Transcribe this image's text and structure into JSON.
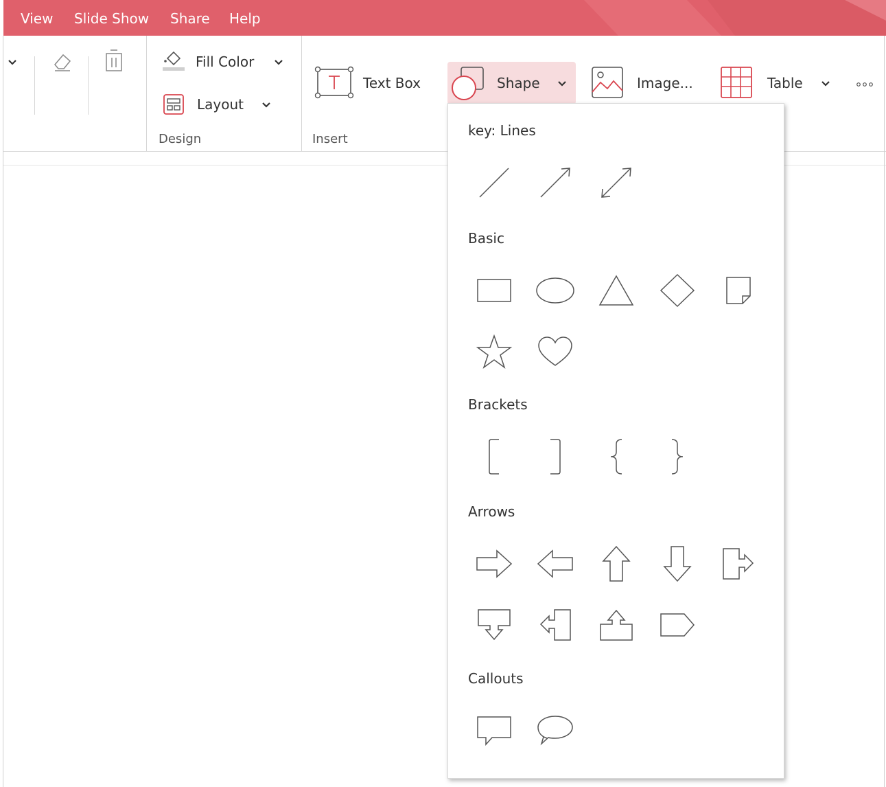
{
  "menubar": {
    "items": [
      "View",
      "Slide Show",
      "Share",
      "Help"
    ],
    "color": "#e0606b"
  },
  "ribbon": {
    "design": {
      "fill_color_label": "Fill Color",
      "layout_label": "Layout",
      "group_label": "Design"
    },
    "insert": {
      "text_box_label": "Text Box",
      "shape_label": "Shape",
      "image_label": "Image...",
      "table_label": "Table",
      "group_label": "Insert"
    },
    "accent": "#d9454f"
  },
  "shape_menu": {
    "sections": [
      {
        "title": "key: Lines",
        "shapes": [
          "line",
          "arrow-line",
          "double-arrow-line"
        ]
      },
      {
        "title": "Basic",
        "shapes": [
          "rectangle",
          "ellipse",
          "triangle",
          "diamond",
          "folded-corner",
          "star",
          "heart"
        ]
      },
      {
        "title": "Brackets",
        "shapes": [
          "left-bracket",
          "right-bracket",
          "left-brace",
          "right-brace"
        ]
      },
      {
        "title": "Arrows",
        "shapes": [
          "right-arrow",
          "left-arrow",
          "up-arrow",
          "down-arrow",
          "right-arrow-callout",
          "down-arrow-callout",
          "left-arrow-callout",
          "up-arrow-callout",
          "pentagon-arrow"
        ]
      },
      {
        "title": "Callouts",
        "shapes": [
          "rectangular-callout",
          "oval-callout"
        ]
      }
    ]
  }
}
